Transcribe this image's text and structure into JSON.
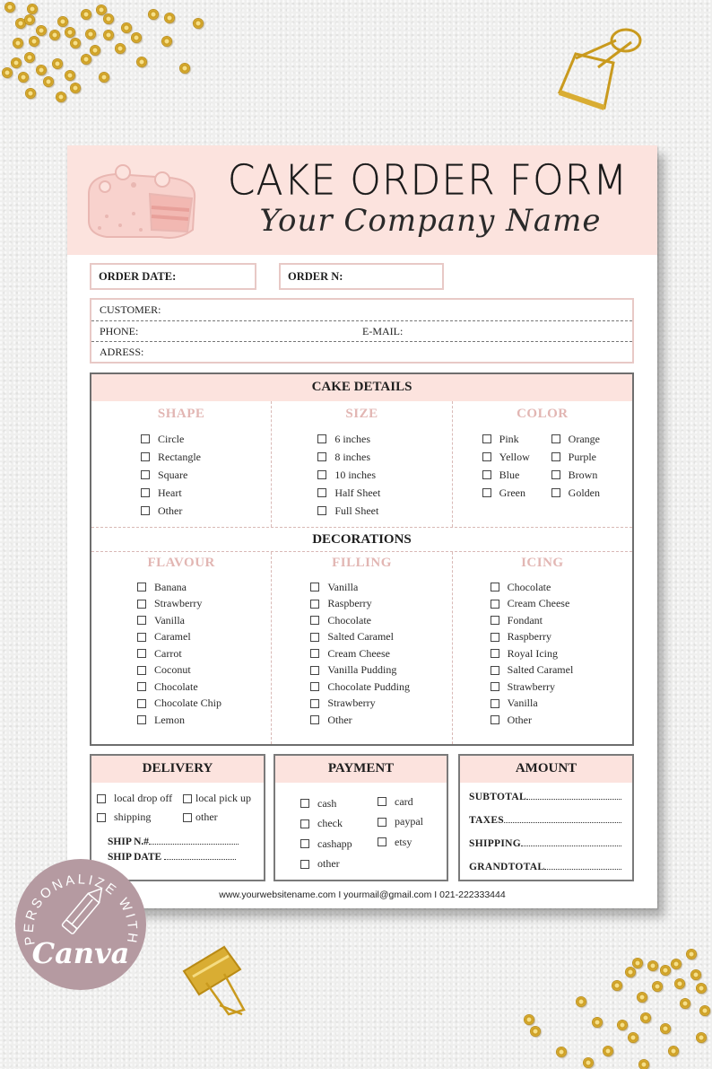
{
  "header": {
    "title": "CAKE ORDER FORM",
    "company": "Your Company Name"
  },
  "order": {
    "date_label": "ORDER DATE:",
    "number_label": "ORDER N:"
  },
  "customer": {
    "customer_label": "CUSTOMER:",
    "phone_label": "PHONE:",
    "email_label": "E-MAIL:",
    "address_label": "ADRESS:"
  },
  "cake_details": {
    "title": "CAKE DETAILS",
    "shape": {
      "title": "SHAPE",
      "options": [
        "Circle",
        "Rectangle",
        "Square",
        "Heart",
        "Other"
      ]
    },
    "size": {
      "title": "SIZE",
      "options": [
        "6 inches",
        "8 inches",
        "10 inches",
        "Half Sheet",
        "Full Sheet"
      ]
    },
    "color": {
      "title": "COLOR",
      "options_left": [
        "Pink",
        "Yellow",
        "Blue",
        "Green"
      ],
      "options_right": [
        "Orange",
        "Purple",
        "Brown",
        "Golden"
      ]
    }
  },
  "decorations": {
    "title": "DECORATIONS",
    "flavour": {
      "title": "FLAVOUR",
      "options": [
        "Banana",
        "Strawberry",
        "Vanilla",
        "Caramel",
        "Carrot",
        "Coconut",
        "Chocolate",
        "Chocolate Chip",
        "Lemon"
      ]
    },
    "filling": {
      "title": "FILLING",
      "options": [
        "Vanilla",
        "Raspberry",
        "Chocolate",
        "Salted Caramel",
        "Cream Cheese",
        "Vanilla Pudding",
        "Chocolate Pudding",
        "Strawberry",
        "Other"
      ]
    },
    "icing": {
      "title": "ICING",
      "options": [
        "Chocolate",
        "Cream Cheese",
        "Fondant",
        "Raspberry",
        "Royal Icing",
        "Salted Caramel",
        "Strawberry",
        "Vanilla",
        "Other"
      ]
    }
  },
  "delivery": {
    "title": "DELIVERY",
    "options": [
      "local drop off",
      "local pick up",
      "shipping",
      "other"
    ],
    "ship_number_label": "SHIP N.#",
    "ship_date_label": "SHIP DATE"
  },
  "payment": {
    "title": "PAYMENT",
    "options_left": [
      "cash",
      "check",
      "cashapp",
      "other"
    ],
    "options_right": [
      "card",
      "paypal",
      "etsy"
    ]
  },
  "amount": {
    "title": "AMOUNT",
    "lines": [
      "SUBTOTAL",
      "TAXES",
      "SHIPPING",
      "GRANDTOTAL"
    ]
  },
  "footer": {
    "contact": "www.yourwebsitename.com I yourmail@gmail.com I 021-222333444"
  },
  "badge": {
    "arc_text": "PERSONALIZE WITH",
    "brand": "Canva"
  },
  "colors": {
    "header_pink": "#fce3de",
    "title_pink": "#e2b6b3",
    "badge_mauve": "#b59aa1",
    "gold": "#d4a52a"
  }
}
